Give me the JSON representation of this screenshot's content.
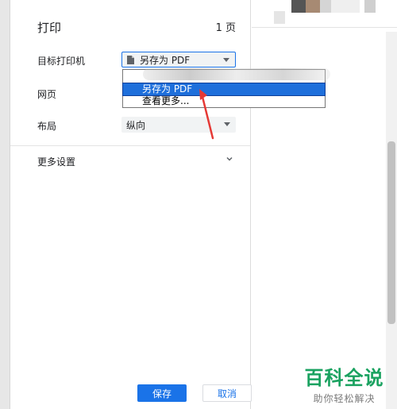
{
  "dialog": {
    "title": "打印",
    "page_count": "1 页",
    "printer_label": "目标打印机",
    "printer_value": "另存为 PDF",
    "pages_label": "网页",
    "layout_label": "布局",
    "layout_value": "纵向",
    "more_settings_label": "更多设置",
    "save_button": "保存",
    "cancel_button": "取消"
  },
  "printer_dropdown": {
    "options": [
      "另存为 PDF",
      "查看更多..."
    ],
    "selected": "另存为 PDF"
  },
  "watermark": {
    "title": "百科全说",
    "subtitle": "助你轻松解决"
  },
  "colors": {
    "accent": "#1a73e8",
    "arrow": "#e53935",
    "watermark_green": "#1aa260"
  },
  "icons": [
    "document-icon",
    "dropdown-caret-icon",
    "chevron-down-icon",
    "red-arrow-annotation"
  ]
}
